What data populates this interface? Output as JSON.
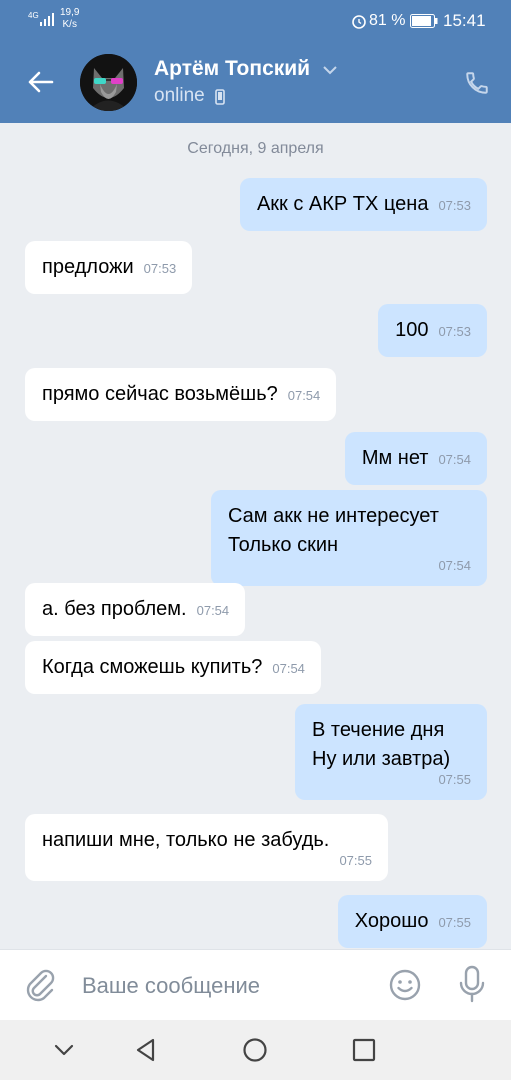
{
  "status_bar": {
    "network": "4G",
    "speed_value": "19,9",
    "speed_unit": "K/s",
    "battery": "81 %",
    "time": "15:41"
  },
  "header": {
    "contact_name": "Артём Топский",
    "contact_status": "online"
  },
  "chat": {
    "date_separator": "Сегодня, 9 апреля",
    "messages": [
      {
        "direction": "out",
        "text": "Акк с АКР ТХ цена",
        "time": "07:53"
      },
      {
        "direction": "in",
        "text": "предложи",
        "time": "07:53"
      },
      {
        "direction": "out",
        "text": "100",
        "time": "07:53"
      },
      {
        "direction": "in",
        "text": "прямо сейчас возьмёшь?",
        "time": "07:54"
      },
      {
        "direction": "out",
        "text": "Мм нет",
        "time": "07:54"
      },
      {
        "direction": "out",
        "text": "Сам акк не интересует\nТолько скин",
        "time": "07:54"
      },
      {
        "direction": "in",
        "text": "а. без проблем.",
        "time": "07:54"
      },
      {
        "direction": "in",
        "text": "Когда сможешь купить?",
        "time": "07:54"
      },
      {
        "direction": "out",
        "text": "В течение дня\nНу или завтра)",
        "time": "07:55"
      },
      {
        "direction": "in",
        "text": "напиши мне, только не забудь.",
        "time": "07:55"
      },
      {
        "direction": "out",
        "text": "Хорошо",
        "time": "07:55"
      }
    ]
  },
  "composer": {
    "placeholder": "Ваше сообщение"
  },
  "colors": {
    "header_bg": "#5181b8",
    "incoming_bubble": "#ffffff",
    "outgoing_bubble": "#cce4ff",
    "chat_bg": "#ebeef2"
  }
}
